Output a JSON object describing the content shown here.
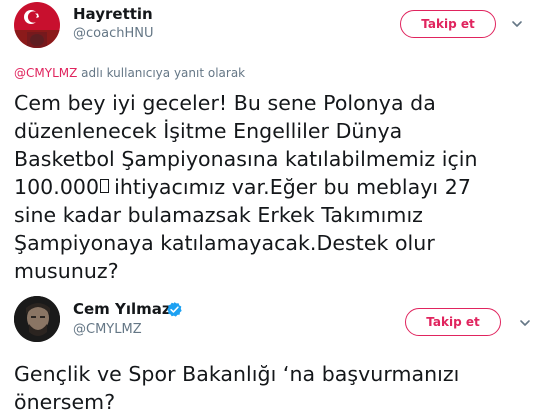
{
  "tweet1": {
    "author_name": "Hayrettin",
    "author_handle": "@coachHNU",
    "follow_label": "Takip et",
    "reply_mention": "@CMYLMZ",
    "reply_suffix": " adlı kullanıcıya yanıt olarak",
    "text_lines": [
      "Cem bey iyi geceler! Bu sene Polonya da",
      "düzenlenecek İşitme Engelliler Dünya",
      "Basketbol Şampiyonasına katılabilmemiz için",
      "100.000",
      "ihtiyacımız var.Eğer bu meblayı 27",
      "sine kadar bulamazsak Erkek Takımımız",
      "Şampiyonaya katılamayacak.Destek olur",
      "musunuz?"
    ],
    "icons": [
      "avatar-flag",
      "chevron-down-icon",
      "missing-glyph"
    ]
  },
  "tweet2": {
    "author_name": "Cem Yılmaz",
    "author_handle": "@CMYLMZ",
    "follow_label": "Takip et",
    "verified": true,
    "text_lines": [
      "Gençlik ve Spor Bakanlığı ‘na başvurmanızı",
      "önersem?"
    ],
    "icons": [
      "avatar-photo",
      "verified-badge-icon",
      "chevron-down-icon"
    ]
  },
  "colors": {
    "accent": "#e0245e",
    "text": "#14171a",
    "secondary": "#657786",
    "verified": "#1da1f2"
  }
}
